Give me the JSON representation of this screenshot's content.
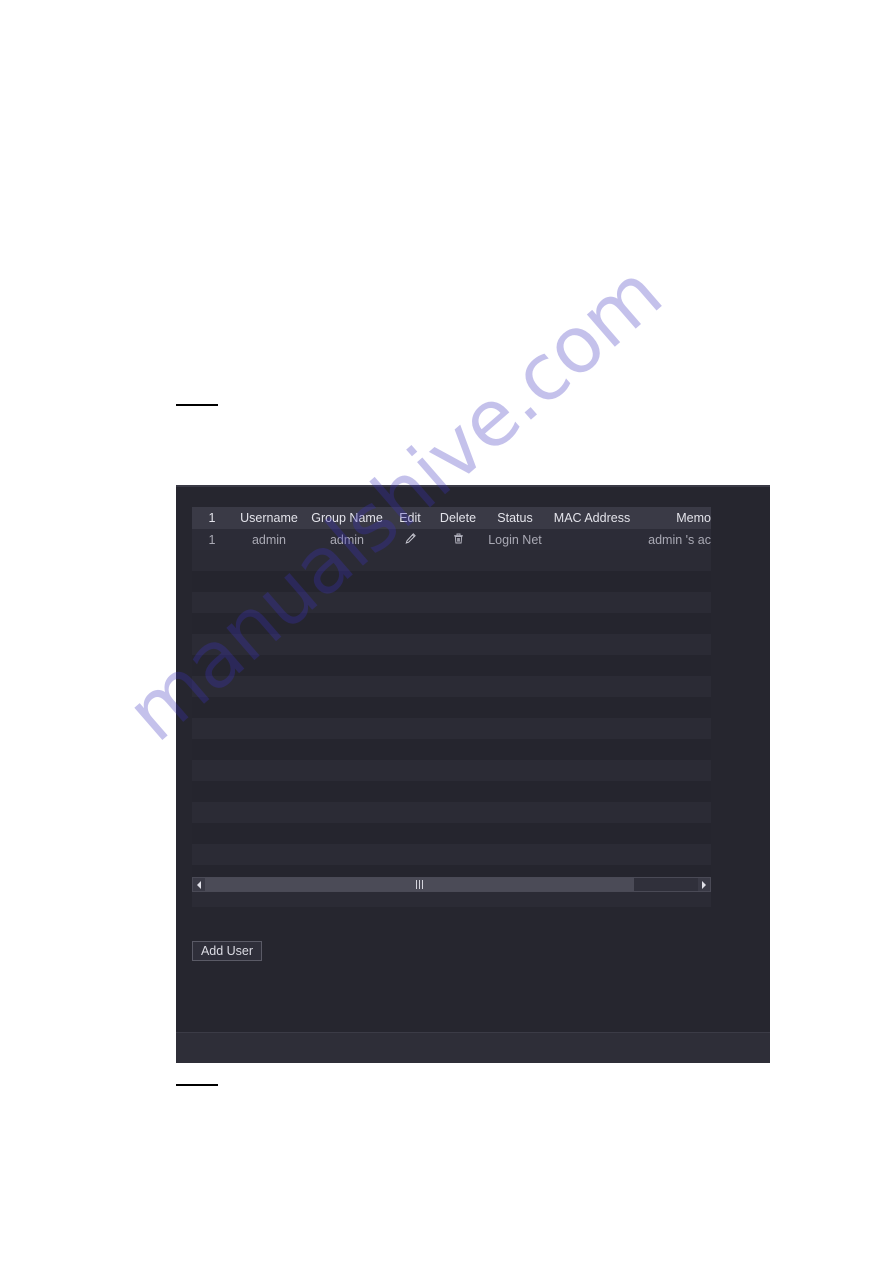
{
  "page": {
    "background": "#ffffff",
    "redaction_marks": 2
  },
  "watermark": {
    "text": "manualshive.com",
    "color": "#3c32be"
  },
  "panel": {
    "background": "#26262f",
    "footer_background": "#2e2e38"
  },
  "table": {
    "columns": [
      {
        "key": "index",
        "label": "1"
      },
      {
        "key": "username",
        "label": "Username"
      },
      {
        "key": "group",
        "label": "Group Name"
      },
      {
        "key": "edit",
        "label": "Edit"
      },
      {
        "key": "delete",
        "label": "Delete"
      },
      {
        "key": "status",
        "label": "Status"
      },
      {
        "key": "mac",
        "label": "MAC Address"
      },
      {
        "key": "memo",
        "label": "Memo"
      }
    ],
    "rows": [
      {
        "index": "1",
        "username": "admin",
        "group": "admin",
        "edit_icon": "pencil-icon",
        "delete_icon": "trash-icon",
        "status": "Login Net",
        "mac": "",
        "memo": "admin 's ac"
      }
    ],
    "empty_row_count": 17,
    "memo_truncated": true
  },
  "scrollbar": {
    "left_arrow_icon": "caret-left-icon",
    "right_arrow_icon": "caret-right-icon",
    "orientation": "horizontal",
    "thumb_position_percent": 0
  },
  "buttons": {
    "add_user": "Add User"
  }
}
